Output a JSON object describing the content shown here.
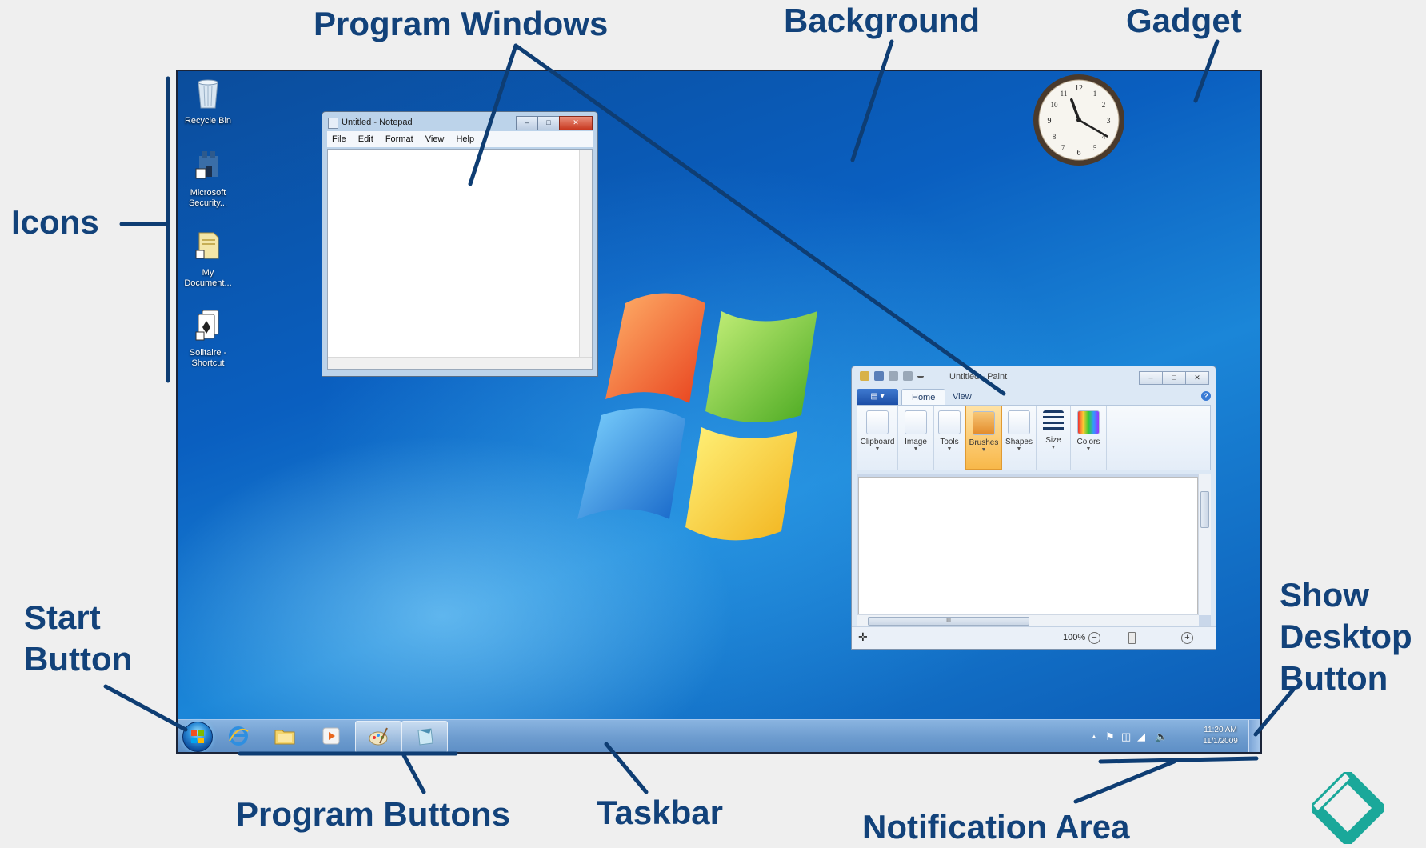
{
  "callouts": {
    "program_windows": "Program Windows",
    "background": "Background",
    "gadget": "Gadget",
    "icons": "Icons",
    "start_button": "Start\nButton",
    "show_desktop_button": "Show\nDesktop\nButton",
    "program_buttons": "Program Buttons",
    "taskbar": "Taskbar",
    "notification_area": "Notification Area"
  },
  "desktop_icons": [
    {
      "label": "Recycle Bin",
      "icon": "recycle-bin-icon"
    },
    {
      "label": "Microsoft\nSecurity...",
      "icon": "microsoft-security-icon"
    },
    {
      "label": "My\nDocument...",
      "icon": "my-documents-icon"
    },
    {
      "label": "Solitaire -\nShortcut",
      "icon": "solitaire-icon"
    }
  ],
  "notepad": {
    "title": "Untitled - Notepad",
    "menu": [
      "File",
      "Edit",
      "Format",
      "View",
      "Help"
    ]
  },
  "paint": {
    "title": "Untitled - Paint",
    "tabs": [
      "Home",
      "View"
    ],
    "groups": [
      "Clipboard",
      "Image",
      "Tools",
      "Brushes",
      "Shapes",
      "Size",
      "Colors"
    ],
    "selected_group": "Brushes",
    "zoom": "100%",
    "scroll_grip": "III"
  },
  "clock": {
    "hour": 11,
    "minute": 20
  },
  "taskbar": {
    "programs": [
      {
        "icon": "internet-explorer-icon"
      },
      {
        "icon": "windows-explorer-icon"
      },
      {
        "icon": "media-player-icon"
      },
      {
        "icon": "paint-icon",
        "active": true
      },
      {
        "icon": "notepad-icon",
        "active": true
      }
    ],
    "time": "11:20 AM",
    "date": "11/1/2009",
    "tray_expand": "▲"
  },
  "colors": {
    "callout_text": "#12427a",
    "desktop_blue": "#0a5fc0",
    "taskbar": "#6d9ccf"
  }
}
